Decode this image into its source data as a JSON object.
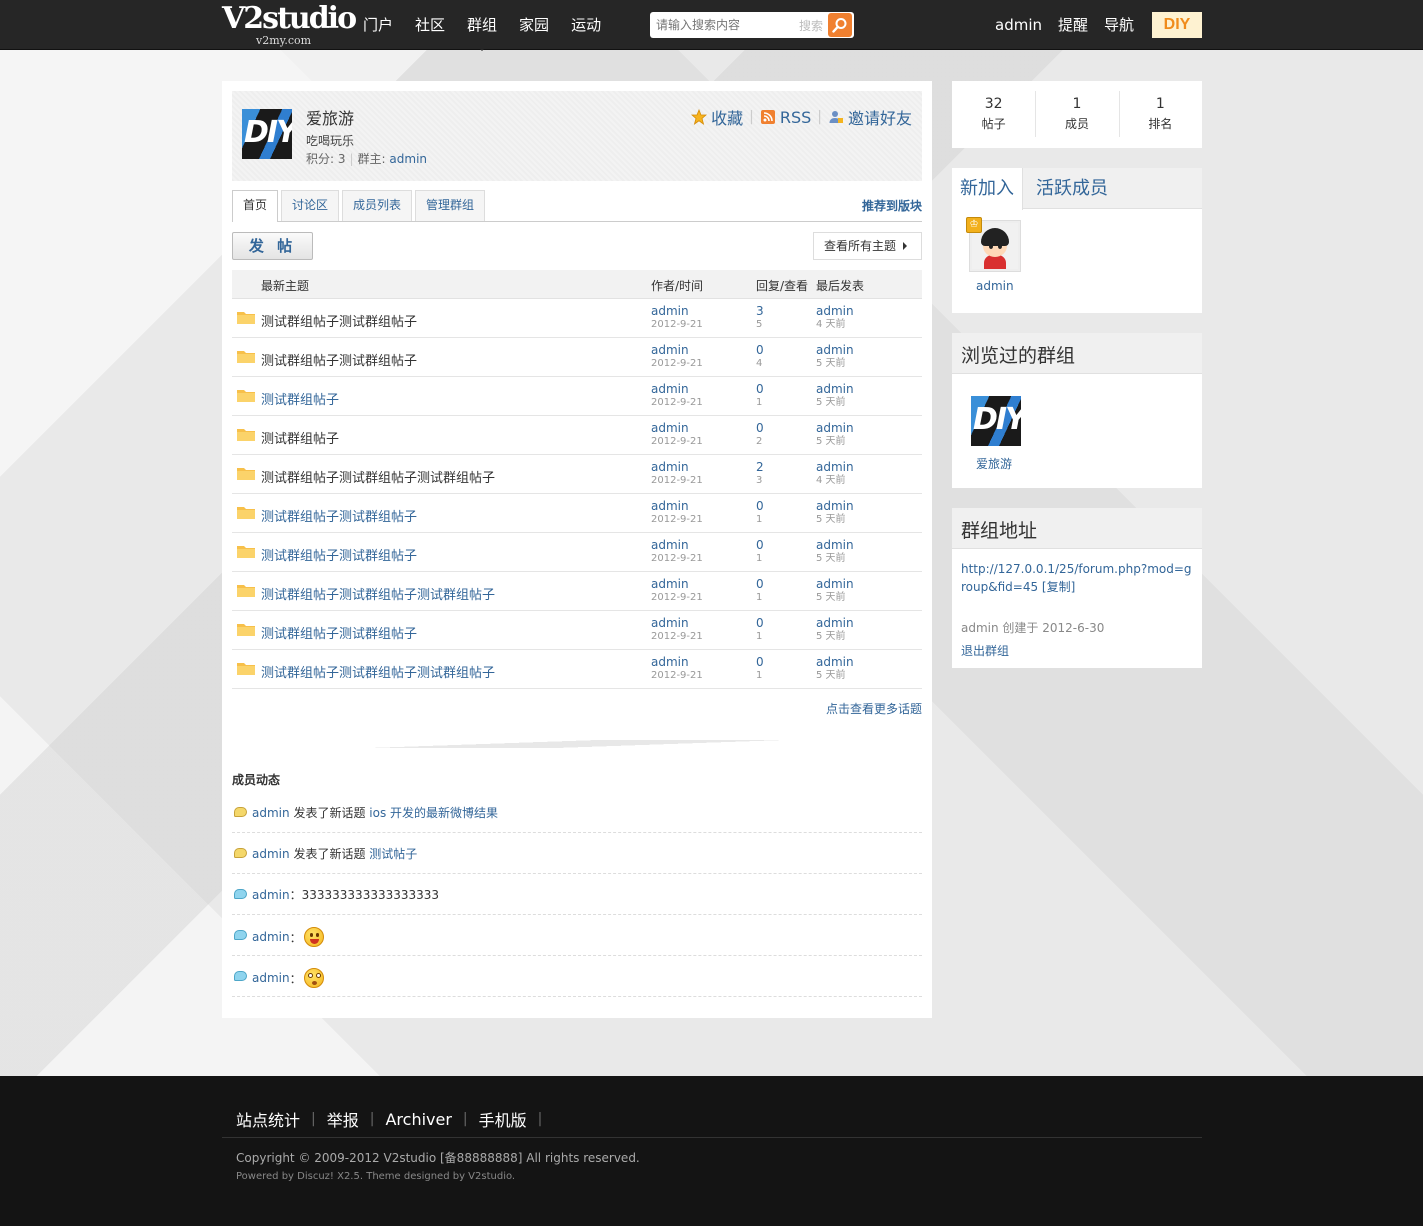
{
  "logo": {
    "main": "V2studio",
    "sub": "v2my.com"
  },
  "nav": [
    {
      "label": "门户"
    },
    {
      "label": "社区"
    },
    {
      "label": "群组",
      "active": true
    },
    {
      "label": "家园"
    },
    {
      "label": "运动"
    }
  ],
  "search": {
    "placeholder": "请输入搜索内容",
    "button_label": "搜索"
  },
  "usernav": {
    "username": "admin",
    "remind": "提醒",
    "navigate": "导航",
    "diy": "DIY"
  },
  "group": {
    "name": "爱旅游",
    "description": "吃喝玩乐",
    "score_label": "积分: 3",
    "owner_label": "群主:",
    "owner": "admin",
    "actions": {
      "favorite": "收藏",
      "rss": "RSS",
      "invite": "邀请好友"
    },
    "logo_text": "DIY"
  },
  "tabs": [
    {
      "label": "首页",
      "active": true
    },
    {
      "label": "讨论区"
    },
    {
      "label": "成员列表"
    },
    {
      "label": "管理群组"
    }
  ],
  "recommend_label": "推荐到版块",
  "post_button": "发 帖",
  "view_all_label": "查看所有主题",
  "thread_headers": {
    "topic": "最新主题",
    "author_time": "作者/时间",
    "reply_view": "回复/查看",
    "last_post": "最后发表"
  },
  "threads": [
    {
      "title": "测试群组帖子测试群组帖子",
      "author": "admin",
      "date": "2012-9-21",
      "replies": "3",
      "views": "5",
      "last_author": "admin",
      "last_time": "4 天前",
      "style": "dark"
    },
    {
      "title": "测试群组帖子测试群组帖子",
      "author": "admin",
      "date": "2012-9-21",
      "replies": "0",
      "views": "4",
      "last_author": "admin",
      "last_time": "5 天前",
      "style": "dark"
    },
    {
      "title": "测试群组帖子",
      "author": "admin",
      "date": "2012-9-21",
      "replies": "0",
      "views": "1",
      "last_author": "admin",
      "last_time": "5 天前",
      "style": "link"
    },
    {
      "title": "测试群组帖子",
      "author": "admin",
      "date": "2012-9-21",
      "replies": "0",
      "views": "2",
      "last_author": "admin",
      "last_time": "5 天前",
      "style": "dark"
    },
    {
      "title": "测试群组帖子测试群组帖子测试群组帖子",
      "author": "admin",
      "date": "2012-9-21",
      "replies": "2",
      "views": "3",
      "last_author": "admin",
      "last_time": "4 天前",
      "style": "dark"
    },
    {
      "title": "测试群组帖子测试群组帖子",
      "author": "admin",
      "date": "2012-9-21",
      "replies": "0",
      "views": "1",
      "last_author": "admin",
      "last_time": "5 天前",
      "style": "link"
    },
    {
      "title": "测试群组帖子测试群组帖子",
      "author": "admin",
      "date": "2012-9-21",
      "replies": "0",
      "views": "1",
      "last_author": "admin",
      "last_time": "5 天前",
      "style": "link"
    },
    {
      "title": "测试群组帖子测试群组帖子测试群组帖子",
      "author": "admin",
      "date": "2012-9-21",
      "replies": "0",
      "views": "1",
      "last_author": "admin",
      "last_time": "5 天前",
      "style": "link"
    },
    {
      "title": "测试群组帖子测试群组帖子",
      "author": "admin",
      "date": "2012-9-21",
      "replies": "0",
      "views": "1",
      "last_author": "admin",
      "last_time": "5 天前",
      "style": "link"
    },
    {
      "title": "测试群组帖子测试群组帖子测试群组帖子",
      "author": "admin",
      "date": "2012-9-21",
      "replies": "0",
      "views": "1",
      "last_author": "admin",
      "last_time": "5 天前",
      "style": "link"
    }
  ],
  "more_label": "点击查看更多话题",
  "feed_title": "成员动态",
  "feed": [
    {
      "user": "admin",
      "action": "发表了新话题",
      "target": "ios 开发的最新微博结果",
      "bubble": "y"
    },
    {
      "user": "admin",
      "action": "发表了新话题",
      "target": "测试帖子",
      "bubble": "y"
    },
    {
      "user": "admin",
      "text": "：333333333333333333",
      "bubble": "b"
    },
    {
      "user": "admin",
      "text": "：",
      "emoji": "grin-icon",
      "bubble": "b"
    },
    {
      "user": "admin",
      "text": "：",
      "emoji": "surprised-icon",
      "bubble": "b"
    }
  ],
  "stats": [
    {
      "value": "32",
      "label": "帖子"
    },
    {
      "value": "1",
      "label": "成员"
    },
    {
      "value": "1",
      "label": "排名"
    }
  ],
  "members_tabs": {
    "new": "新加入",
    "active": "活跃成员"
  },
  "member": {
    "name": "admin"
  },
  "visited": {
    "title": "浏览过的群组",
    "group_name": "爱旅游"
  },
  "address": {
    "title": "群组地址",
    "url": "http://127.0.0.1/25/forum.php?mod=group&fid=45",
    "copy_label": "[复制]",
    "created": "admin 创建于 2012-6-30",
    "leave": "退出群组"
  },
  "footer": {
    "links": [
      "站点统计",
      "举报",
      "Archiver",
      "手机版"
    ],
    "copyright": "Copyright © 2009-2012 V2studio [备88888888] All rights reserved.",
    "powered": "Powered by Discuz! X2.5. Theme designed by V2studio."
  },
  "colors": {
    "link": "#336699",
    "topbar": "#262626",
    "accent": "#f08030",
    "footer": "#141414"
  }
}
